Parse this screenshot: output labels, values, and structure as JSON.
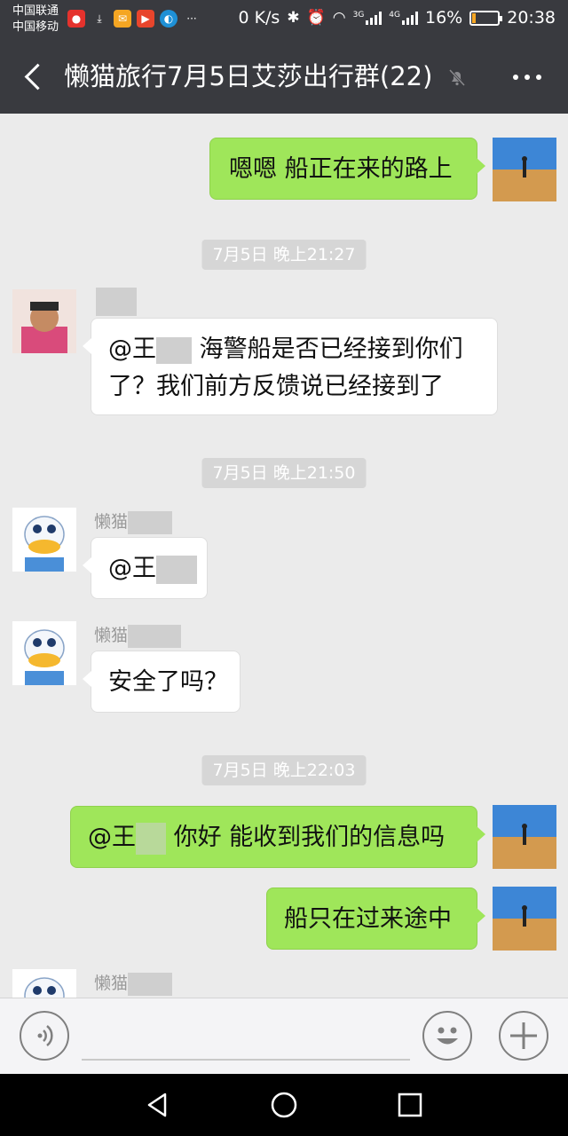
{
  "status_bar": {
    "carrier_1": "中国联通",
    "carrier_2": "中国移动",
    "speed": "0 K/s",
    "network_1": "3G",
    "network_2": "4G",
    "battery": "16%",
    "battery_level": 0.16,
    "time": "20:38"
  },
  "header": {
    "title": "懒猫旅行7月5日艾莎出行群(22)"
  },
  "messages": {
    "m1": {
      "text": "嗯嗯 船正在来的路上"
    },
    "ts1": "7月5日 晚上21:27",
    "m2": {
      "line1_prefix": "@王",
      "line1_suffix": " 海警船是否已经接到你们",
      "line2": "了？我们前方反馈说已经接到了"
    },
    "ts2": "7月5日 晚上21:50",
    "m3": {
      "sender": "懒猫",
      "text": "@王"
    },
    "m4": {
      "sender": "懒猫",
      "text": "安全了吗？"
    },
    "ts3": "7月5日 晚上22:03",
    "m5": {
      "prefix": "@王",
      "suffix": " 你好 能收到我们的信息吗"
    },
    "m6": {
      "text": "船只在过来途中"
    },
    "m7": {
      "sender": "懒猫"
    }
  },
  "icons": {
    "back": "back-arrow-icon",
    "mute": "bell-off-icon",
    "more": "more-dots-icon",
    "voice": "voice-icon",
    "emoji": "emoji-icon",
    "add": "plus-icon"
  },
  "colors": {
    "header_bg": "#393a3f",
    "outgoing_bubble": "#9fe65a",
    "incoming_bubble": "#ffffff",
    "chat_bg": "#ebebeb"
  }
}
